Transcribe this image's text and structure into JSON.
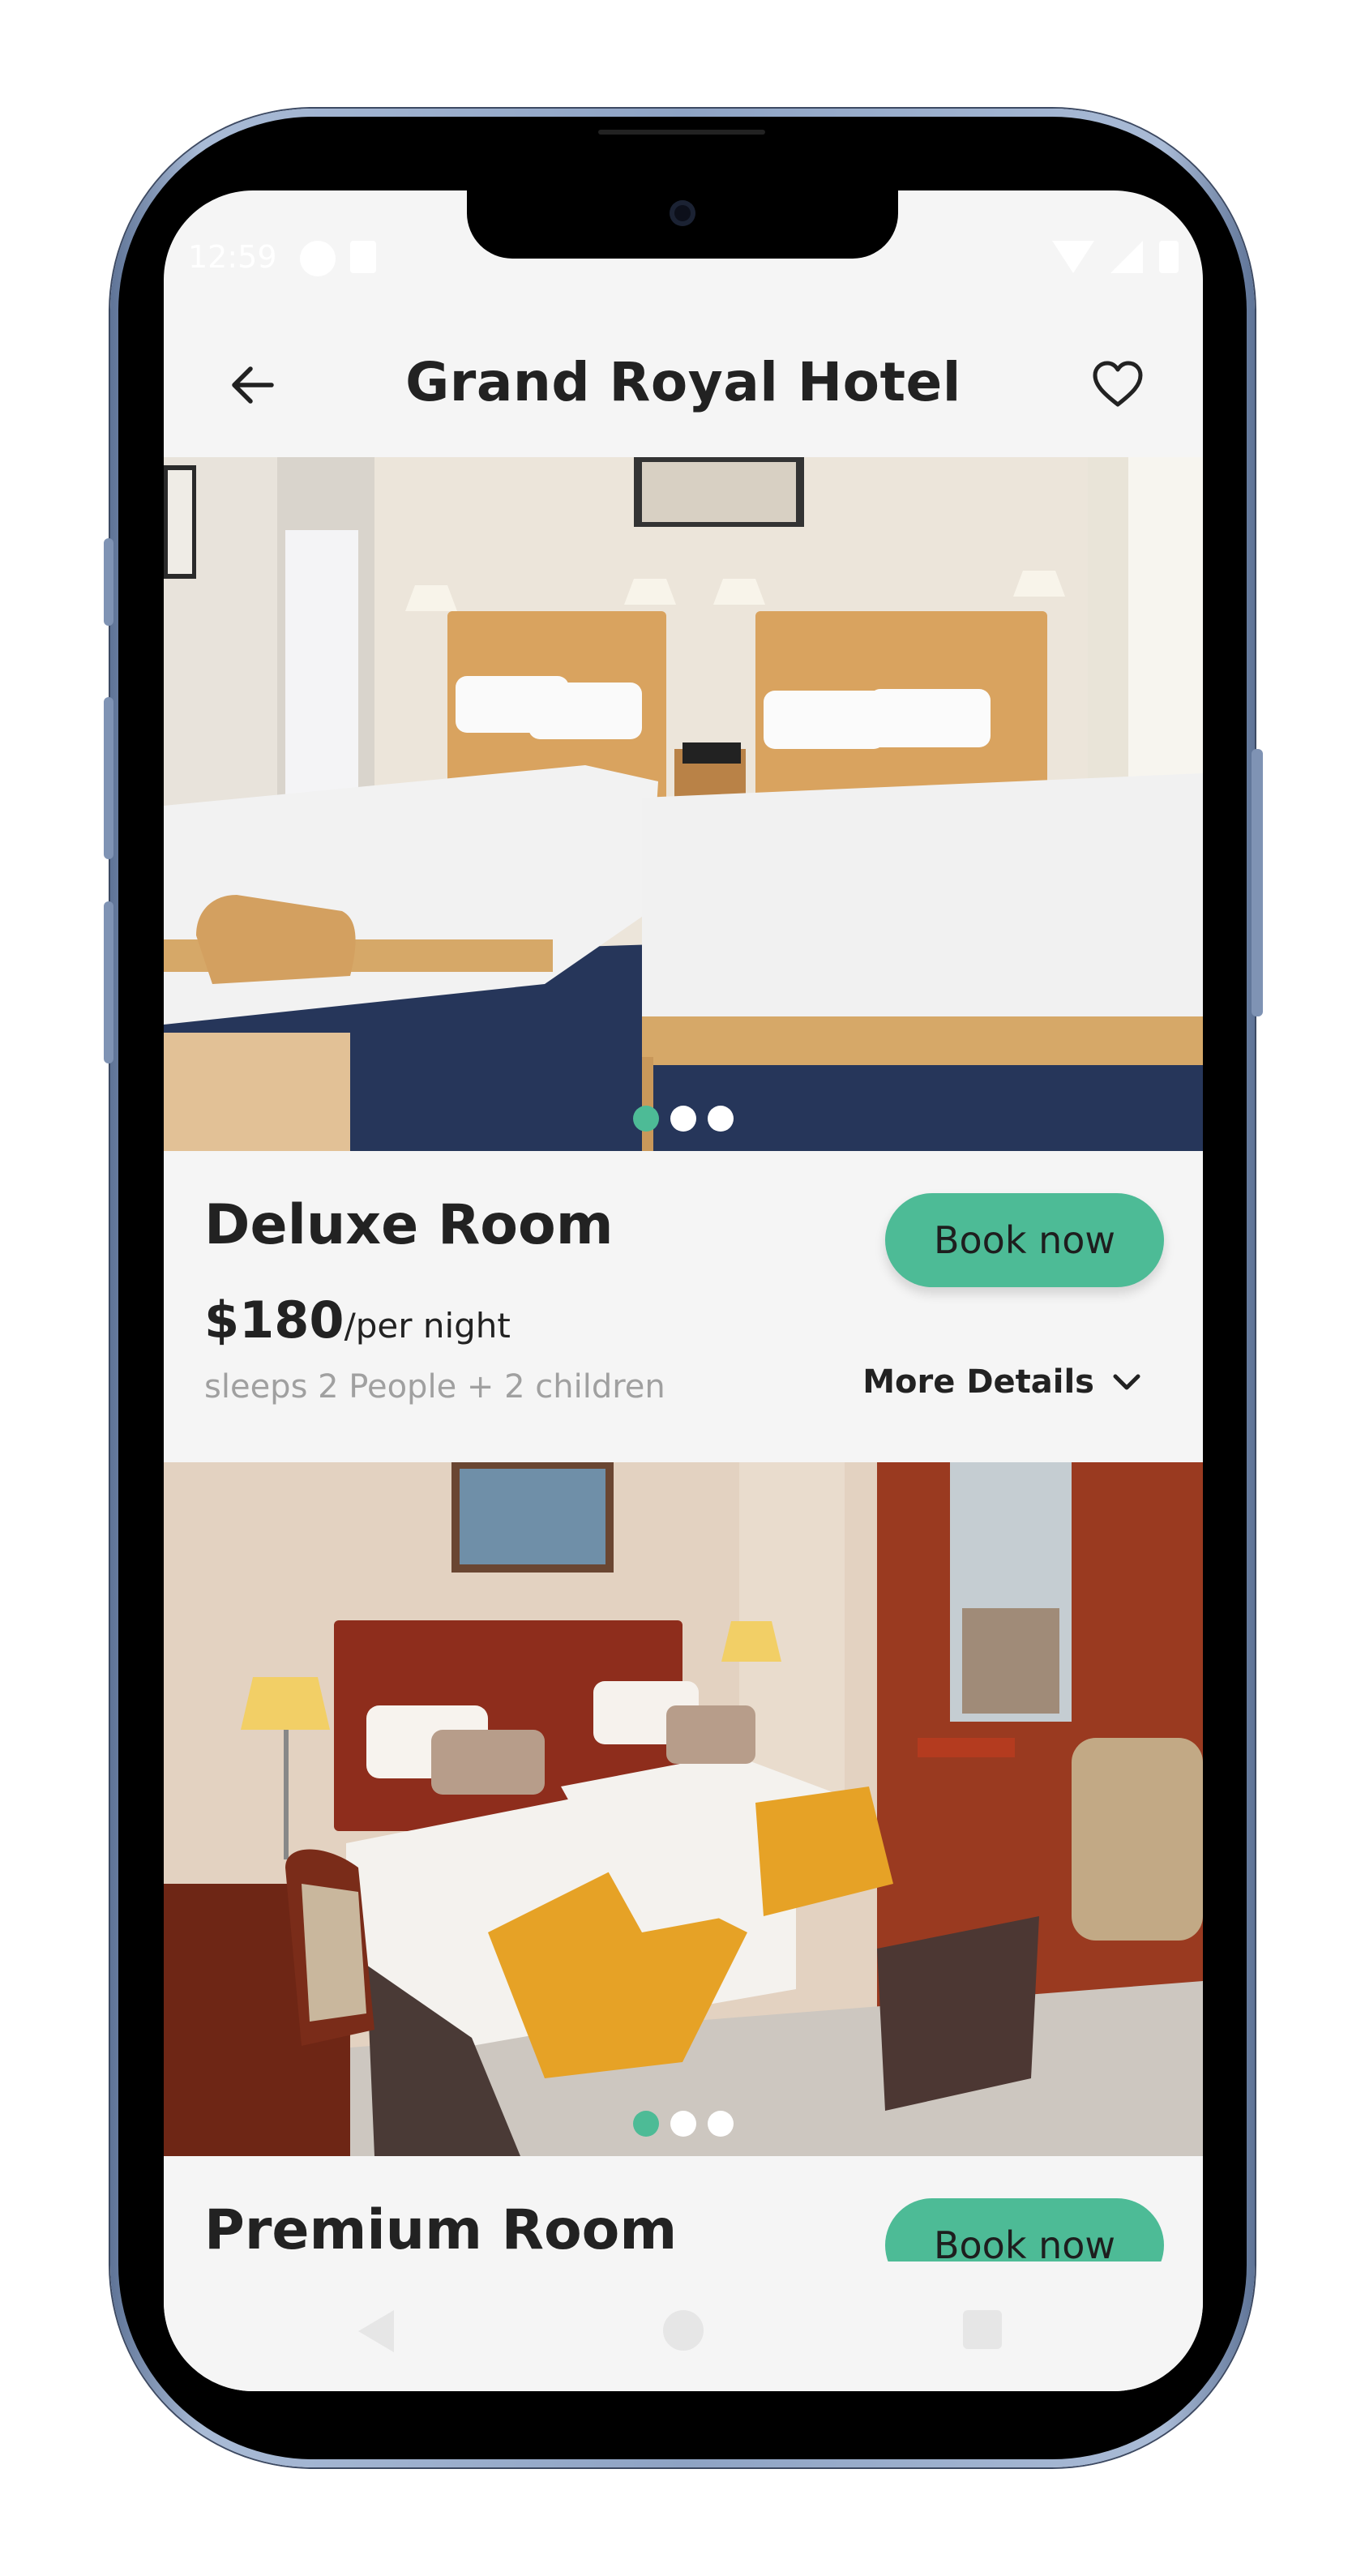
{
  "status_bar": {
    "time": "12:59"
  },
  "header": {
    "title": "Grand Royal Hotel"
  },
  "rooms": [
    {
      "name": "Deluxe Room",
      "price": "$180",
      "price_unit": "/per night",
      "sleeps": "sleeps 2 People + 2 children",
      "book_label": "Book now",
      "details_label": "More Details",
      "carousel": {
        "count": 3,
        "active_index": 0
      }
    },
    {
      "name": "Premium Room",
      "book_label": "Book now",
      "carousel": {
        "count": 3,
        "active_index": 0
      }
    }
  ],
  "colors": {
    "accent": "#4dbb96",
    "background": "#f5f5f5",
    "text": "#222222",
    "muted": "#a0a0a0"
  },
  "icons": [
    "arrow-back-icon",
    "heart-outline-icon",
    "chevron-down-icon"
  ]
}
